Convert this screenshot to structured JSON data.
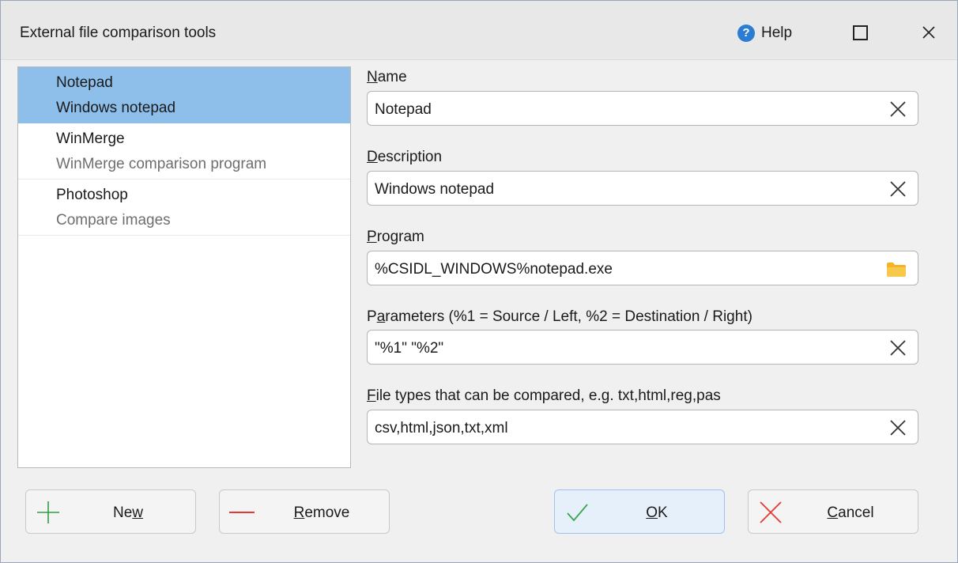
{
  "window": {
    "title": "External file comparison tools"
  },
  "titlebar": {
    "help_label": "Help",
    "help_glyph": "?"
  },
  "tools": [
    {
      "name": "Notepad",
      "description": "Windows notepad",
      "selected": true
    },
    {
      "name": "WinMerge",
      "description": "WinMerge comparison program",
      "selected": false
    },
    {
      "name": "Photoshop",
      "description": "Compare images",
      "selected": false
    }
  ],
  "form": {
    "name": {
      "label_pre": "",
      "label_key": "N",
      "label_post": "ame",
      "value": "Notepad"
    },
    "description": {
      "label_pre": "",
      "label_key": "D",
      "label_post": "escription",
      "value": "Windows notepad"
    },
    "program": {
      "label_pre": "",
      "label_key": "P",
      "label_post": "rogram",
      "value": "%CSIDL_WINDOWS%notepad.exe"
    },
    "parameters": {
      "label_pre": "P",
      "label_key": "a",
      "label_post": "rameters (%1 = Source / Left, %2 = Destination / Right)",
      "value": "\"%1\" \"%2\""
    },
    "file_types": {
      "label_pre": "",
      "label_key": "F",
      "label_post": "ile types that can be compared, e.g. txt,html,reg,pas",
      "value": "csv,html,json,txt,xml"
    }
  },
  "buttons": {
    "new": {
      "pre": "Ne",
      "key": "w",
      "post": ""
    },
    "remove": {
      "pre": "",
      "key": "R",
      "post": "emove"
    },
    "ok": {
      "pre": "",
      "key": "O",
      "post": "K"
    },
    "cancel": {
      "pre": "",
      "key": "C",
      "post": "ancel"
    }
  },
  "colors": {
    "selection": "#8dbfea",
    "new_icon": "#2e9e3f",
    "remove_icon": "#e53935",
    "ok_icon": "#3aa54a",
    "cancel_icon": "#e53935",
    "folder_icon": "#f5b325",
    "help_icon": "#2b7cd3"
  }
}
